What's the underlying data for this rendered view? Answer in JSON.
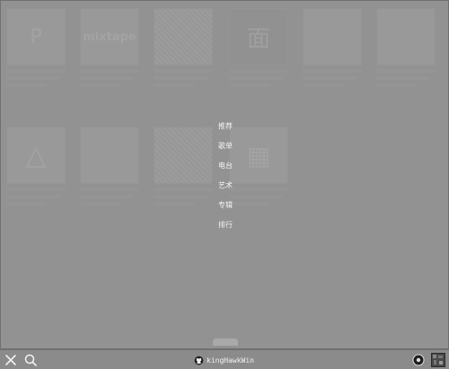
{
  "menu": {
    "items": [
      "推荐",
      "歌单",
      "电台",
      "艺术",
      "专辑",
      "排行"
    ]
  },
  "cards": [
    {
      "glyph": "P"
    },
    {
      "glyph": "mixtape"
    },
    {
      "glyph": ""
    },
    {
      "glyph": "面"
    },
    {
      "glyph": ""
    },
    {
      "glyph": ""
    },
    {
      "glyph": "△"
    },
    {
      "glyph": ""
    },
    {
      "glyph": ""
    },
    {
      "glyph": "▦"
    }
  ],
  "bottombar": {
    "username": "kingHawkWin",
    "close_icon": "close-icon",
    "search_icon": "search-icon",
    "github_icon": "github-icon",
    "settings_icon": "gear-icon",
    "avatar_icon": "avatar"
  }
}
